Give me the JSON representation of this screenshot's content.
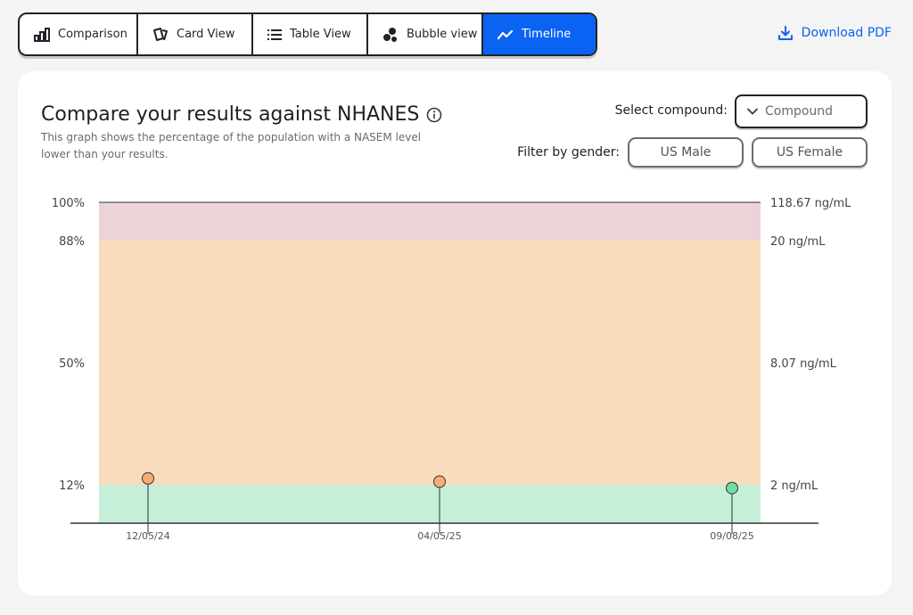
{
  "tabs": [
    {
      "label": "Comparison",
      "icon": "bar-chart-icon",
      "active": false
    },
    {
      "label": "Card View",
      "icon": "cards-icon",
      "active": false
    },
    {
      "label": "Table View",
      "icon": "list-icon",
      "active": false
    },
    {
      "label": "Bubble view",
      "icon": "bubbles-icon",
      "active": false
    },
    {
      "label": "Timeline",
      "icon": "trend-icon",
      "active": true
    }
  ],
  "download": {
    "label": "Download PDF",
    "icon": "download-icon",
    "color": "#0b63f3"
  },
  "card": {
    "title": "Compare your results against NHANES",
    "subtitle": "This graph shows the percentage of the population with a NASEM level lower than your results.",
    "compound_label": "Select compound:",
    "compound_value": "Compound",
    "gender_label": "Filter by gender:",
    "gender_options": [
      "US Male",
      "US Female"
    ]
  },
  "chart_data": {
    "type": "scatter",
    "left_axis_labels": [
      "100%",
      "88%",
      "50%",
      "12%"
    ],
    "right_axis_labels": [
      "118.67 ng/mL",
      "20 ng/mL",
      "8.07 ng/mL",
      "2 ng/mL"
    ],
    "bands": [
      {
        "from": 0,
        "to": 12,
        "color": "#c6efd9"
      },
      {
        "from": 12,
        "to": 88,
        "color": "#f9dcbc"
      },
      {
        "from": 88,
        "to": 100,
        "color": "#ebd3d8"
      }
    ],
    "points": [
      {
        "x": "12/05/24",
        "y": 14,
        "color": "#f6ad73"
      },
      {
        "x": "04/05/25",
        "y": 13,
        "color": "#f6ad73"
      },
      {
        "x": "09/08/25",
        "y": 11,
        "color": "#6fe0a3"
      }
    ]
  }
}
